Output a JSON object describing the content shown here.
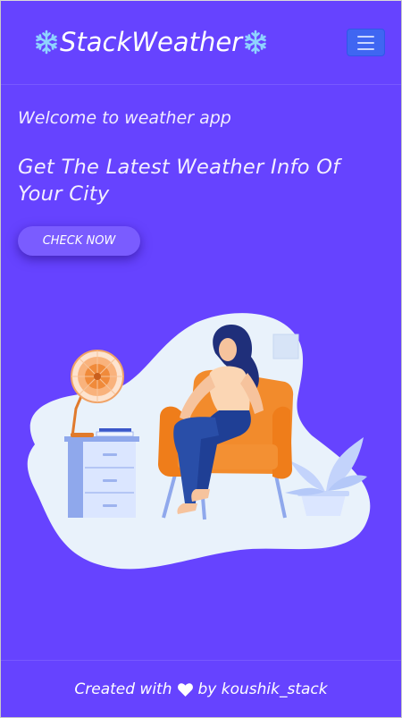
{
  "navbar": {
    "brand_text": "StackWeather",
    "brand_icon": "snowflake-icon",
    "toggle_icon": "hamburger-menu-icon"
  },
  "hero": {
    "welcome": "Welcome to weather app",
    "headline": "Get The Latest Weather Info Of Your City",
    "cta_label": "CHECK NOW"
  },
  "illustration": {
    "name": "woman-in-armchair-with-fan-illustration"
  },
  "footer": {
    "prefix": "Created with",
    "heart_icon": "heart-icon",
    "suffix": "by koushik_stack"
  },
  "colors": {
    "background": "#6643ff",
    "toggler": "#3f66f2",
    "button": "#7a5cff",
    "snowflake": "#8fd3ff"
  }
}
